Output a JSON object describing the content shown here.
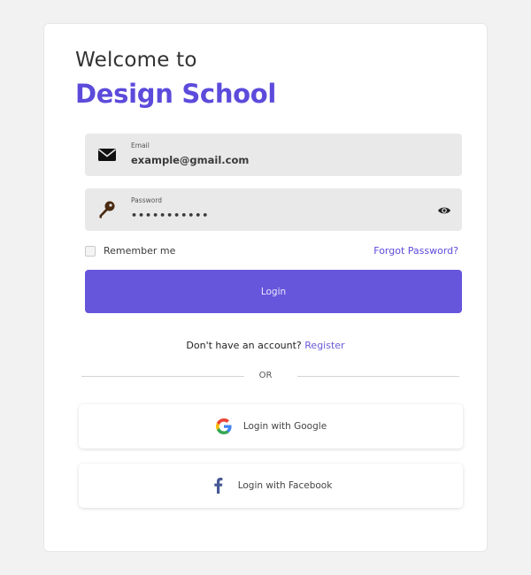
{
  "header": {
    "welcome_text": "Welcome to",
    "brand_name": "Design School"
  },
  "form": {
    "email": {
      "label": "Email",
      "value": "example@gmail.com",
      "icon": "envelope-icon"
    },
    "password": {
      "label": "Password",
      "value": "•••••••••••",
      "icon": "key-icon",
      "toggle_icon": "eye-icon"
    },
    "remember_me_label": "Remember me",
    "remember_me_checked": false,
    "forgot_password_label": "Forgot Password?",
    "login_button_label": "Login"
  },
  "signup": {
    "prompt": "Don't have an account?",
    "register_label": "Register"
  },
  "divider": {
    "label": "OR"
  },
  "social": {
    "google_label": "Login with Google",
    "google_icon": "google-icon",
    "facebook_label": "Login with Facebook",
    "facebook_icon": "facebook-icon"
  },
  "colors": {
    "accent": "#5c4bdb",
    "button": "#6656dc",
    "background": "#f2f2f2",
    "field_bg": "#e9e9e9",
    "facebook": "#475993"
  }
}
